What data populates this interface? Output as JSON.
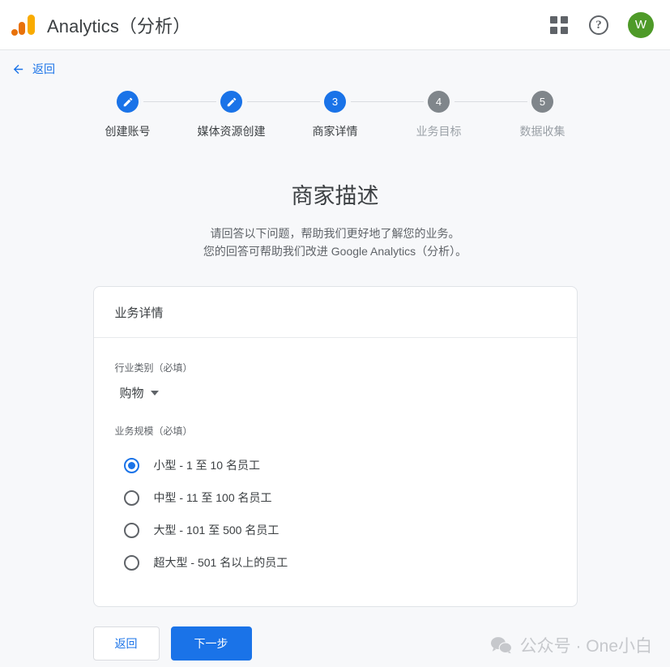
{
  "header": {
    "logo_name": "google-analytics-logo",
    "app_title": "Analytics（分析）",
    "apps_icon": "apps-grid-icon",
    "help_icon": "help-icon",
    "help_glyph": "?",
    "avatar_initial": "W",
    "avatar_color": "#4e9a28"
  },
  "back_bar": {
    "label": "返回",
    "icon": "arrow-left-icon",
    "color": "#1a73e8"
  },
  "stepper": {
    "active_index": 2,
    "steps": [
      {
        "number": "1",
        "label": "创建账号",
        "state": "done",
        "icon": "pencil-icon"
      },
      {
        "number": "2",
        "label": "媒体资源创建",
        "state": "done",
        "icon": "pencil-icon"
      },
      {
        "number": "3",
        "label": "商家详情",
        "state": "active",
        "icon": ""
      },
      {
        "number": "4",
        "label": "业务目标",
        "state": "todo",
        "icon": ""
      },
      {
        "number": "5",
        "label": "数据收集",
        "state": "todo",
        "icon": ""
      }
    ],
    "colors": {
      "active": "#1a73e8",
      "todo": "#80868b",
      "connector": "#dadce0"
    }
  },
  "page": {
    "title": "商家描述",
    "subtitle_line1": "请回答以下问题，帮助我们更好地了解您的业务。",
    "subtitle_line2": "您的回答可帮助我们改进 Google Analytics（分析）。"
  },
  "card": {
    "header_title": "业务详情",
    "industry": {
      "label": "行业类别（必填）",
      "value": "购物",
      "caret_icon": "chevron-down-icon"
    },
    "business_size": {
      "label": "业务规模（必填）",
      "selected_index": 0,
      "options": [
        "小型 - 1 至 10 名员工",
        "中型 - 11 至 100 名员工",
        "大型 - 101 至 500 名员工",
        "超大型 - 501 名以上的员工"
      ]
    }
  },
  "actions": {
    "back_label": "返回",
    "next_label": "下一步",
    "primary_color": "#1a73e8"
  },
  "watermark": {
    "icon": "wechat-icon",
    "text": "公众号 · One小白"
  }
}
